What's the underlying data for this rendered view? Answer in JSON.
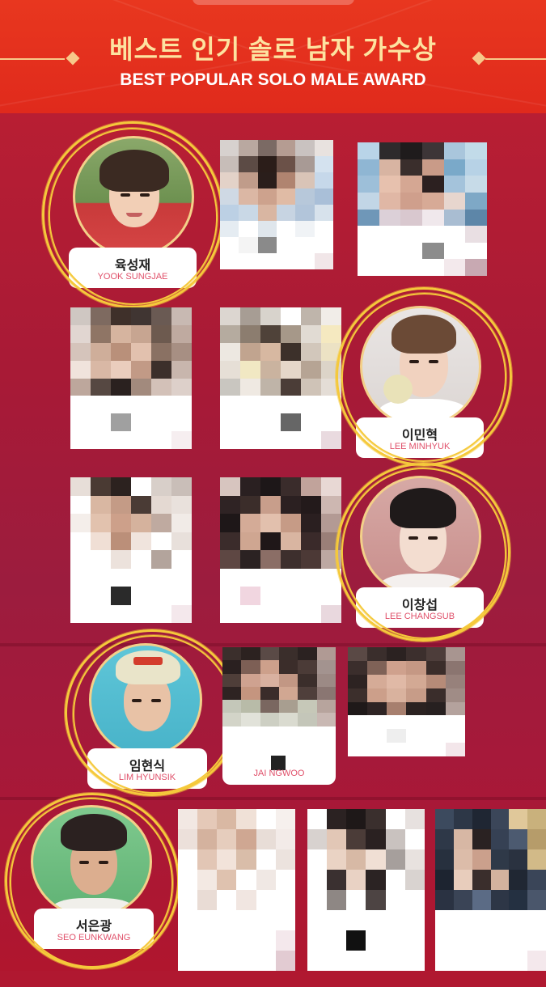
{
  "header": {
    "title_ko": "베스트 인기 솔로 남자 가수상",
    "title_en": "BEST POPULAR SOLO MALE AWARD"
  },
  "nominees": [
    {
      "name_ko": "육성재",
      "name_en": "YOOK SUNGJAE"
    },
    {
      "name_ko": "이민혁",
      "name_en": "LEE MINHYUK"
    },
    {
      "name_ko": "이창섭",
      "name_en": "LEE CHANGSUB"
    },
    {
      "name_ko": "임현식",
      "name_en": "LIM HYUNSIK"
    },
    {
      "name_ko": "서은광",
      "name_en": "SEO EUNKWANG"
    }
  ],
  "partial_labels": {
    "row4_col2": "JAI    NGWOO"
  },
  "colors": {
    "header_red": "#e02a1c",
    "title_gold": "#fde3a0",
    "body_crimson": "#b01830",
    "highlight_circle": "#f5c93b",
    "name_en_pink": "#e0506a"
  }
}
